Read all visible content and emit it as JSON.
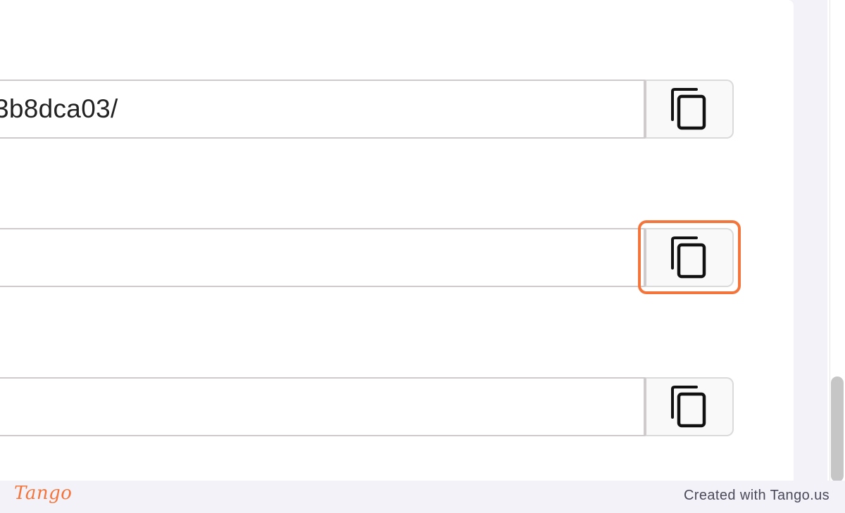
{
  "fields": [
    {
      "value": "3b8dca03/",
      "copy_icon": "copy-icon"
    },
    {
      "value": "",
      "copy_icon": "copy-icon"
    },
    {
      "value": "",
      "copy_icon": "copy-icon"
    }
  ],
  "highlight_color": "#f4753c",
  "footer": {
    "brand": "Tango",
    "credit": "Created with Tango.us"
  }
}
